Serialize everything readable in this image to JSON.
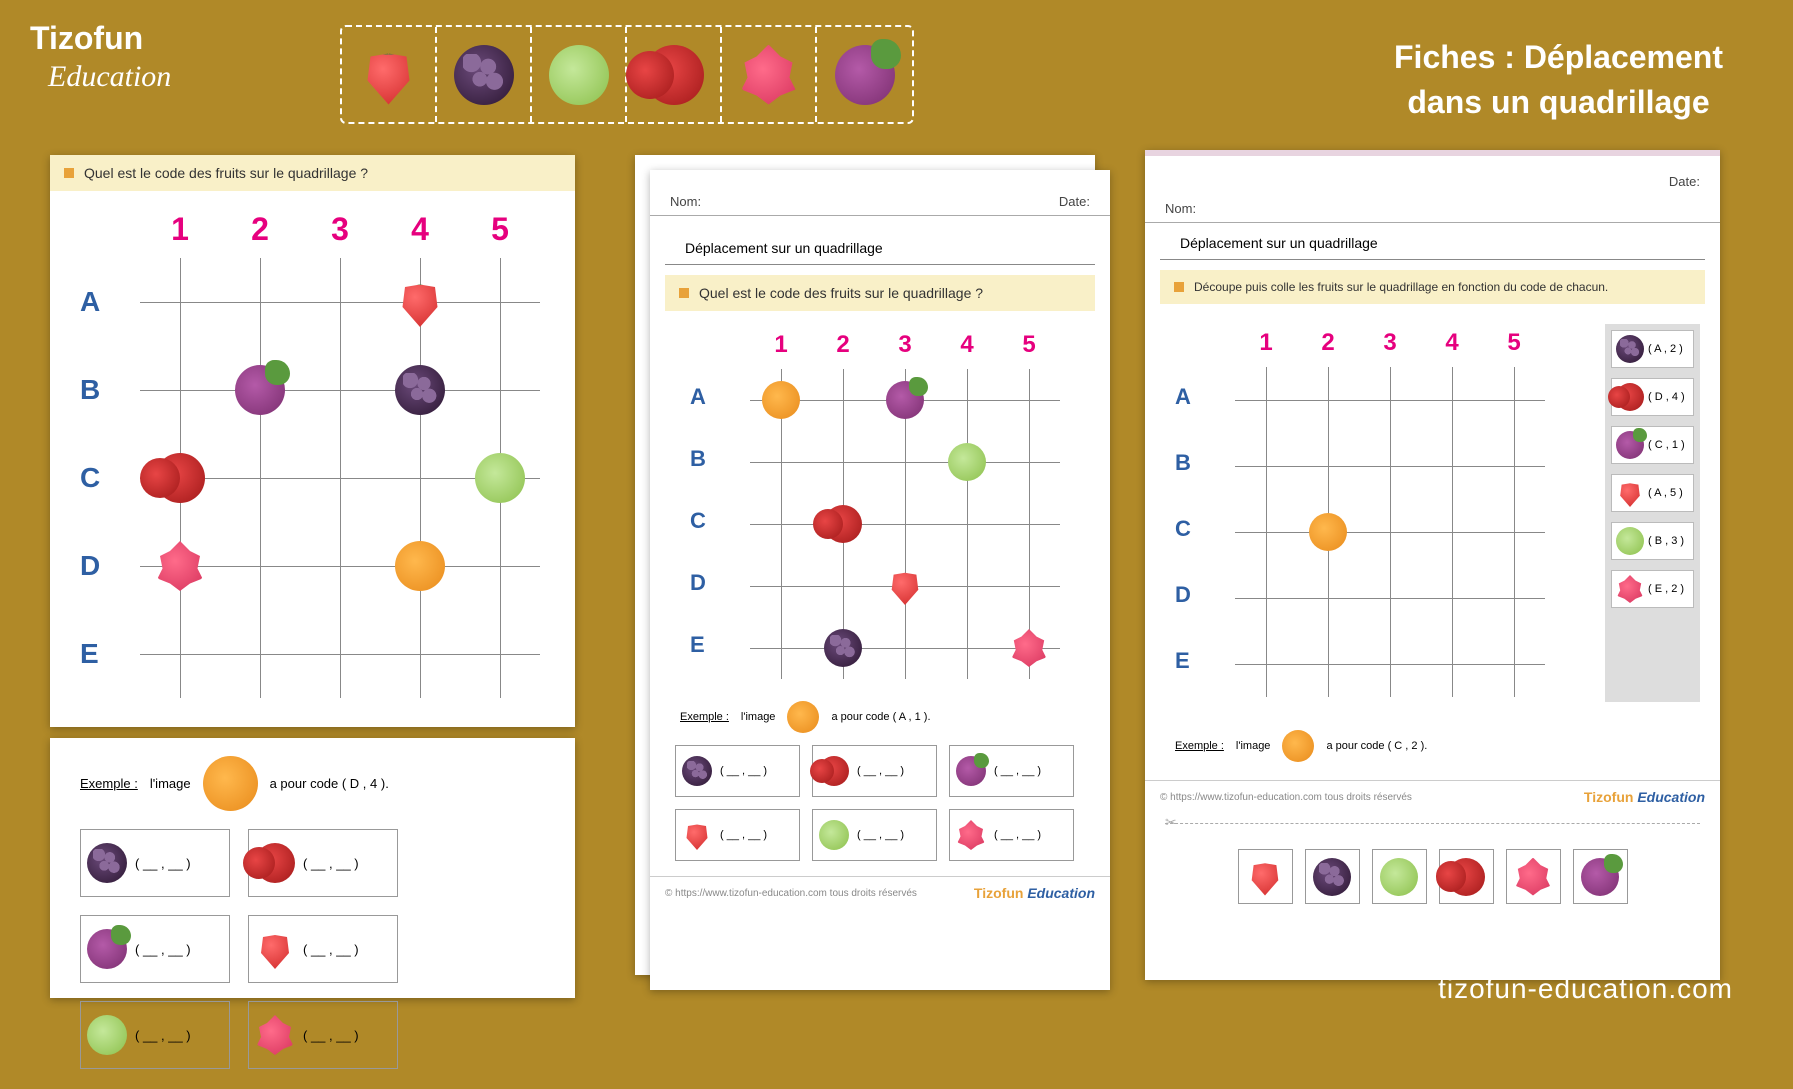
{
  "brand": {
    "name1": "Tizofun",
    "name2": "Education"
  },
  "website": "tizofun-education.com",
  "title_line1": "Fiches : Déplacement",
  "title_line2": "dans un quadrillage",
  "header_fruits": [
    "strawberry",
    "blackberry",
    "apple",
    "cherry",
    "dragonfruit",
    "grape"
  ],
  "card1": {
    "banner": "Quel est le code des fruits sur le quadrillage ?",
    "cols": [
      "1",
      "2",
      "3",
      "4",
      "5"
    ],
    "rows": [
      "A",
      "B",
      "C",
      "D",
      "E"
    ],
    "items": [
      {
        "fruit": "strawberry",
        "col": 4,
        "row": 1
      },
      {
        "fruit": "grape",
        "col": 2,
        "row": 2
      },
      {
        "fruit": "blackberry",
        "col": 4,
        "row": 2
      },
      {
        "fruit": "cherry",
        "col": 1,
        "row": 3
      },
      {
        "fruit": "apple",
        "col": 5,
        "row": 3
      },
      {
        "fruit": "dragonfruit",
        "col": 1,
        "row": 4
      },
      {
        "fruit": "orange",
        "col": 4,
        "row": 4
      }
    ]
  },
  "card1b": {
    "example_label": "Exemple :",
    "example_text": "l'image",
    "example_fruit": "orange",
    "example_code": "a pour code (  D  ,  4  ).",
    "answers": [
      "blackberry",
      "cherry",
      "grape",
      "strawberry",
      "apple",
      "dragonfruit"
    ],
    "blank": "( __ , __ )"
  },
  "card2": {
    "nom": "Nom:",
    "date": "Date:",
    "section": "Déplacement sur un quadrillage",
    "banner": "Quel est le code des fruits sur le quadrillage ?",
    "cols": [
      "1",
      "2",
      "3",
      "4",
      "5"
    ],
    "rows": [
      "A",
      "B",
      "C",
      "D",
      "E"
    ],
    "items": [
      {
        "fruit": "orange",
        "col": 1,
        "row": 1
      },
      {
        "fruit": "grape",
        "col": 3,
        "row": 1
      },
      {
        "fruit": "apple",
        "col": 4,
        "row": 2
      },
      {
        "fruit": "cherry",
        "col": 2,
        "row": 3
      },
      {
        "fruit": "strawberry",
        "col": 3,
        "row": 4
      },
      {
        "fruit": "blackberry",
        "col": 2,
        "row": 5
      },
      {
        "fruit": "dragonfruit",
        "col": 5,
        "row": 5
      }
    ],
    "example_label": "Exemple :",
    "example_text": "l'image",
    "example_fruit": "orange",
    "example_code": "a pour code (  A  ,  1  ).",
    "answers": [
      "blackberry",
      "cherry",
      "grape",
      "strawberry",
      "apple",
      "dragonfruit"
    ],
    "blank": "( __ , __ )",
    "footer": "© https://www.tizofun-education.com tous droits réservés"
  },
  "card3": {
    "nom": "Nom:",
    "date": "Date:",
    "section": "Déplacement sur un quadrillage",
    "banner": "Découpe puis colle les fruits sur le quadrillage en fonction du code de chacun.",
    "cols": [
      "1",
      "2",
      "3",
      "4",
      "5"
    ],
    "rows": [
      "A",
      "B",
      "C",
      "D",
      "E"
    ],
    "placed": [
      {
        "fruit": "orange",
        "col": 2,
        "row": 3
      }
    ],
    "side": [
      {
        "fruit": "blackberry",
        "code": "( A , 2 )"
      },
      {
        "fruit": "cherry",
        "code": "( D , 4 )"
      },
      {
        "fruit": "grape",
        "code": "( C , 1 )"
      },
      {
        "fruit": "strawberry",
        "code": "( A , 5 )"
      },
      {
        "fruit": "apple",
        "code": "( B , 3 )"
      },
      {
        "fruit": "dragonfruit",
        "code": "( E , 2 )"
      }
    ],
    "example_label": "Exemple :",
    "example_text": "l'image",
    "example_fruit": "orange",
    "example_code": "a pour code (  C  ,  2  ).",
    "footer": "© https://www.tizofun-education.com tous droits réservés",
    "cut_fruits": [
      "strawberry",
      "blackberry",
      "apple",
      "cherry",
      "dragonfruit",
      "grape"
    ]
  }
}
